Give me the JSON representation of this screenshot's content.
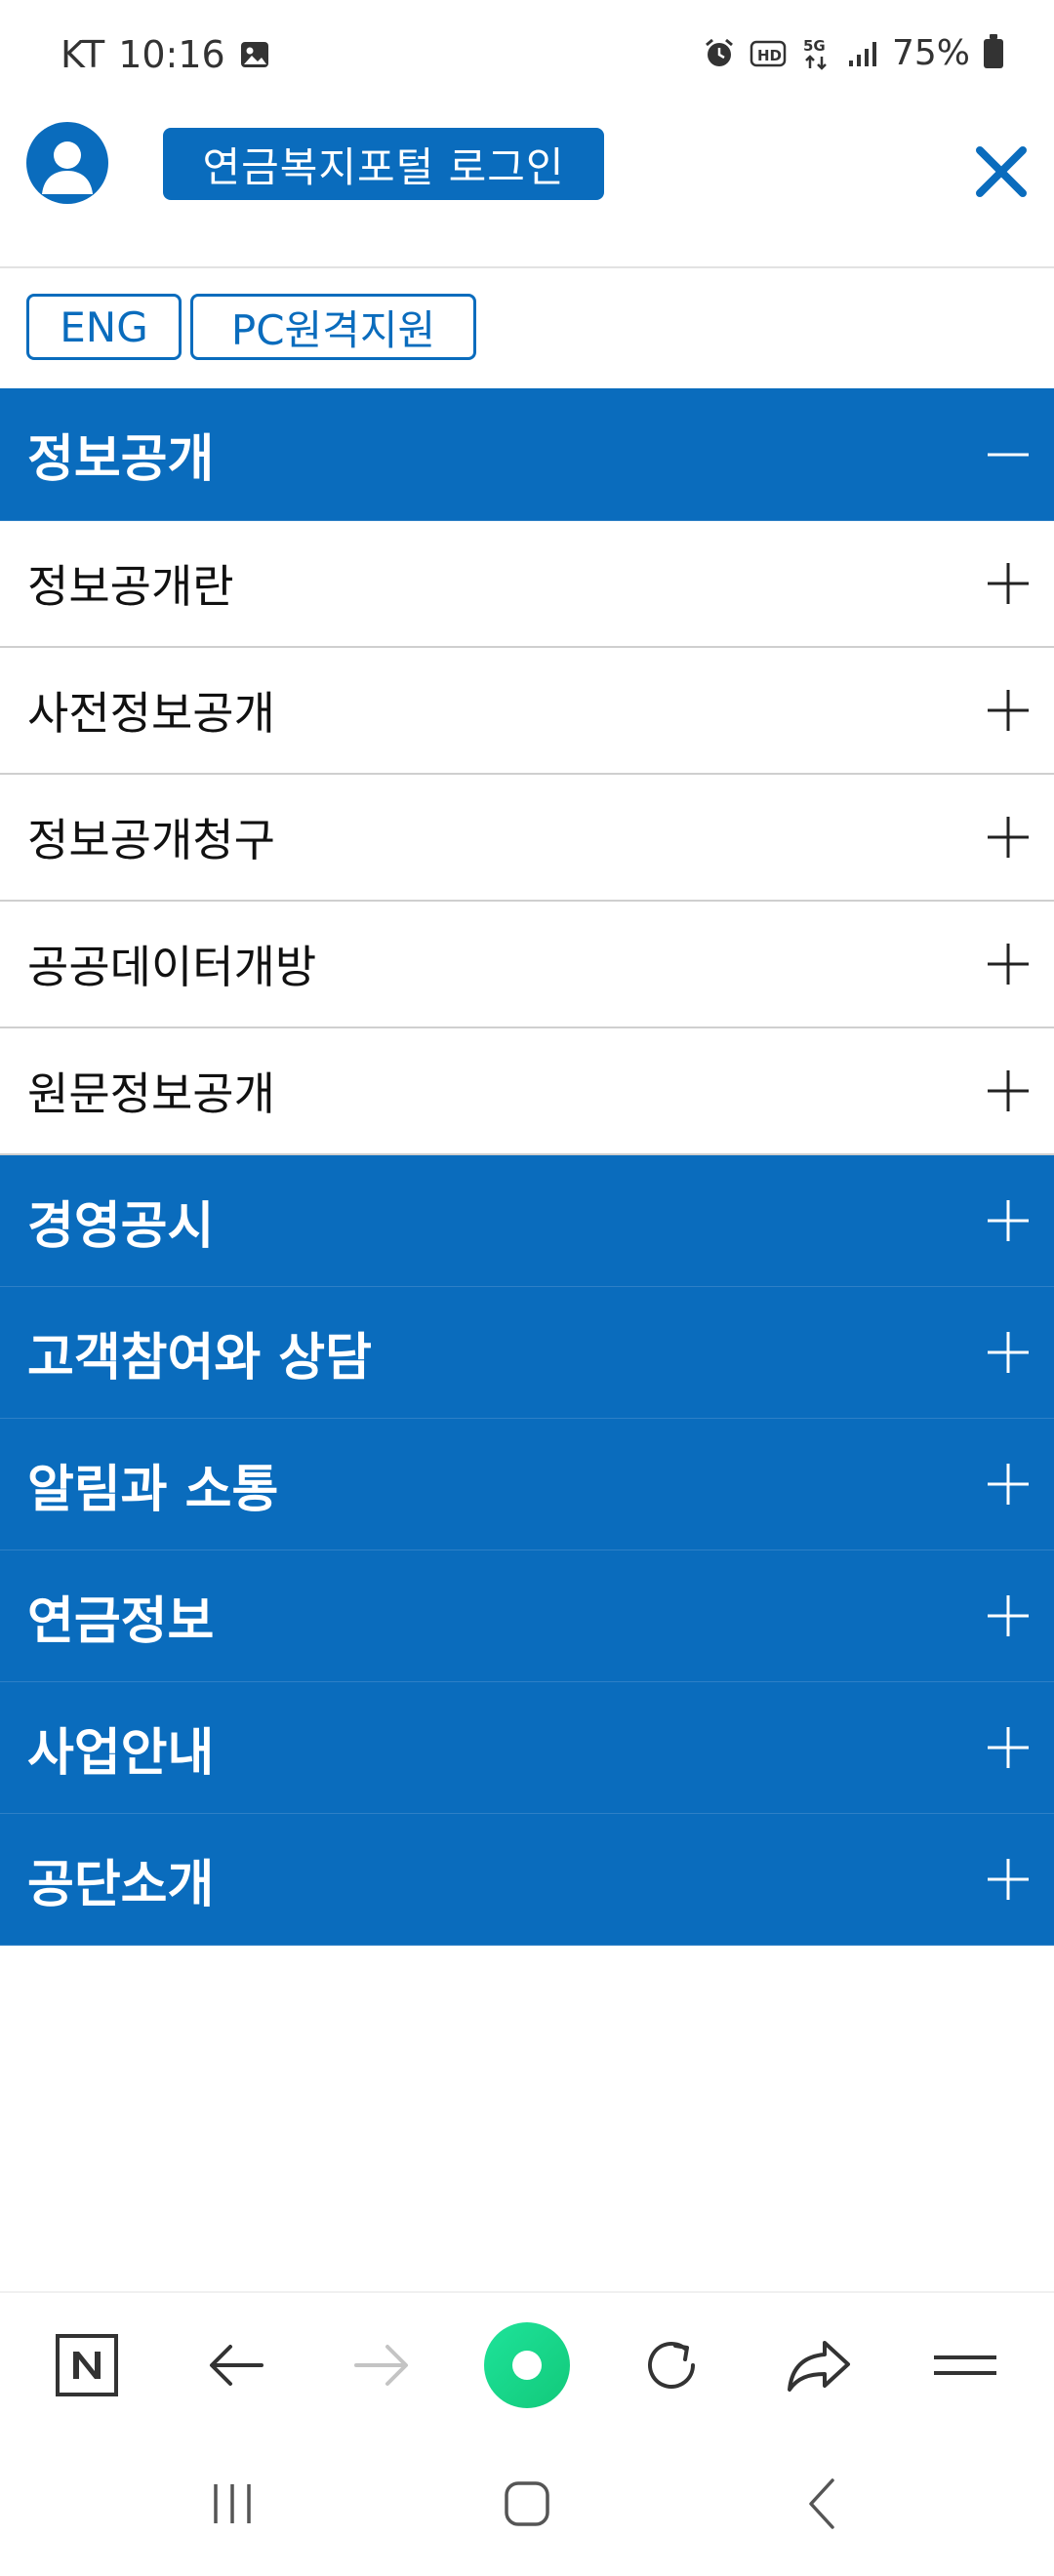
{
  "status_bar": {
    "carrier": "KT",
    "time": "10:16",
    "battery": "75%",
    "icons": [
      "image-icon",
      "alarm-icon",
      "hd-icon",
      "5g-icon",
      "signal-icon",
      "battery-icon"
    ]
  },
  "header": {
    "login_label": "연금복지포털 로그인",
    "avatar_icon": "user-avatar-icon",
    "close_icon": "close-icon"
  },
  "lang_buttons": {
    "eng_label": "ENG",
    "pc_label": "PC원격지원"
  },
  "menu": {
    "open_section": {
      "label": "정보공개",
      "toggle_icon": "minus-icon",
      "items": [
        {
          "label": "정보공개란"
        },
        {
          "label": "사전정보공개"
        },
        {
          "label": "정보공개청구"
        },
        {
          "label": "공공데이터개방"
        },
        {
          "label": "원문정보공개"
        }
      ]
    },
    "sections": [
      {
        "label": "경영공시"
      },
      {
        "label": "고객참여와 상담"
      },
      {
        "label": "알림과 소통"
      },
      {
        "label": "연금정보"
      },
      {
        "label": "사업안내"
      },
      {
        "label": "공단소개"
      }
    ]
  },
  "browser_toolbar": {
    "buttons": [
      "naver-icon",
      "back-arrow-icon",
      "forward-arrow-icon",
      "green-dot-icon",
      "refresh-icon",
      "share-icon",
      "menu-icon"
    ]
  },
  "colors": {
    "brand": "#0a6cbd",
    "divider": "#cfcfcf",
    "green": "#12c97a"
  }
}
